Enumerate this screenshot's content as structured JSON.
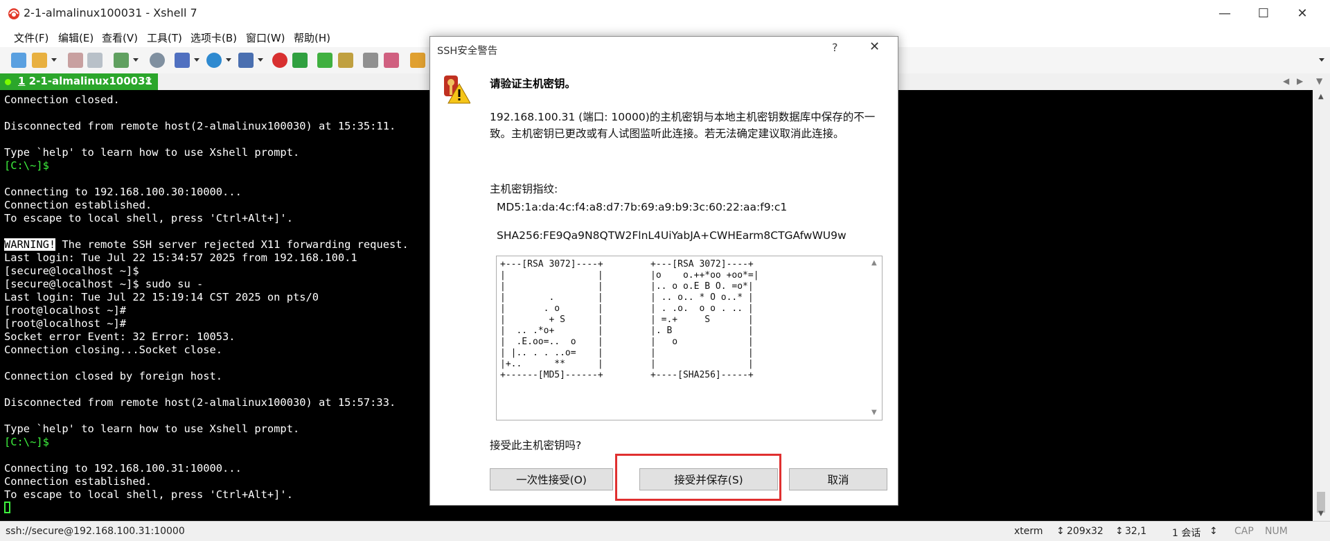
{
  "window": {
    "title": "2-1-almalinux100031 - Xshell 7",
    "minimize": "—",
    "maximize": "☐",
    "close": "✕"
  },
  "menu": [
    "文件(F)",
    "编辑(E)",
    "查看(V)",
    "工具(T)",
    "选项卡(B)",
    "窗口(W)",
    "帮助(H)"
  ],
  "tab": {
    "number": "1",
    "label": "2-1-almalinux100031",
    "close": "×"
  },
  "terminal": {
    "lines": [
      "Connection closed.",
      "",
      "Disconnected from remote host(2-almalinux100030) at 15:35:11.",
      "",
      "Type `help' to learn how to use Xshell prompt.",
      "[C:\\~]$",
      "",
      "Connecting to 192.168.100.30:10000...",
      "Connection established.",
      "To escape to local shell, press 'Ctrl+Alt+]'.",
      "",
      "WARNING!",
      "Last login: Tue Jul 22 15:34:57 2025 from 192.168.100.1",
      "[secure@localhost ~]$",
      "[secure@localhost ~]$ sudo su -",
      "Last login: Tue Jul 22 15:19:14 CST 2025 on pts/0",
      "[root@localhost ~]#",
      "[root@localhost ~]#",
      "Socket error Event: 32 Error: 10053.",
      "Connection closing...Socket close.",
      "",
      "Connection closed by foreign host.",
      "",
      "Disconnected from remote host(2-almalinux100030) at 15:57:33.",
      "",
      "Type `help' to learn how to use Xshell prompt.",
      "[C:\\~]$",
      "",
      "Connecting to 192.168.100.31:10000...",
      "Connection established.",
      "To escape to local shell, press 'Ctrl+Alt+]'."
    ],
    "warning_rest": " The remote SSH server rejected X11 forwarding request."
  },
  "status": {
    "connection": "ssh://secure@192.168.100.31:10000",
    "term": "xterm",
    "size": "209x32",
    "position": "32,1",
    "sessions": "1 会话",
    "cap": "CAP",
    "num": "NUM"
  },
  "dialog": {
    "title": "SSH安全警告",
    "help": "?",
    "close": "✕",
    "heading": "请验证主机密钥。",
    "description": "192.168.100.31 (端口: 10000)的主机密钥与本地主机密钥数据库中保存的不一致。主机密钥已更改或有人试图监听此连接。若无法确定建议取消此连接。",
    "fingerprint_label": "主机密钥指纹:",
    "md5": "MD5:1a:da:4c:f4:a8:d7:7b:69:a9:b9:3c:60:22:aa:f9:c1",
    "sha256": "SHA256:FE9Qa9N8QTW2FlnL4UiYabJA+CWHEarm8CTGAfwWU9w",
    "art_md5": "+---[RSA 3072]----+\n|                 |\n|                 |\n|        .        |\n|       . o       |\n|        + S      |\n|  .. .*o+        |\n|  .E.oo=..  o    |\n| |.. . . ..o=    |\n|+..      **      |\n+------[MD5]------+",
    "art_sha256": "+---[RSA 3072]----+\n|o    o.++*oo +oo*=|\n|.. o o.E B O. =o*|\n| .. o.. * O o..* |\n| . .o.  o o . .. |\n| =.+     S       |\n|. B              |\n|   o             |\n|                 |\n|                 |\n+----[SHA256]-----+",
    "accept_question": "接受此主机密钥吗?",
    "buttons": {
      "accept_once": "一次性接受(O)",
      "accept_save": "接受并保存(S)",
      "cancel": "取消"
    }
  },
  "colors": {
    "tab_green": "#2ba62b",
    "terminal_bg": "#000000",
    "prompt_green": "#3ef23e",
    "highlight_red": "#e03030"
  }
}
